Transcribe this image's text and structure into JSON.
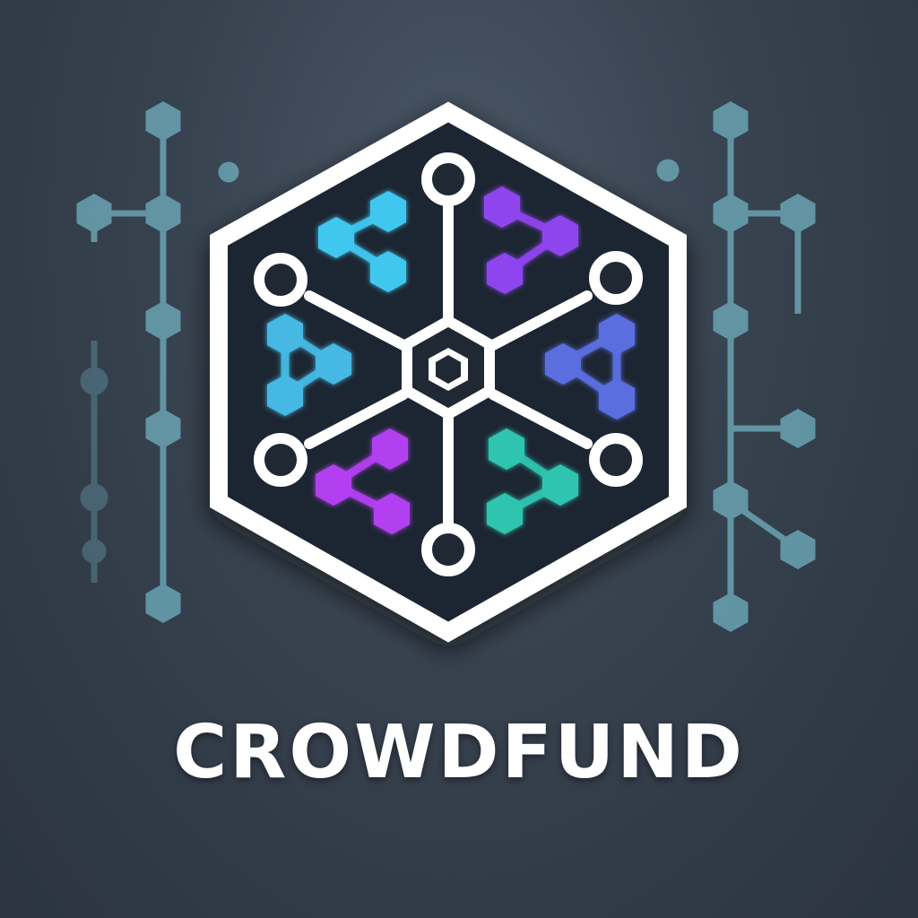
{
  "brand": {
    "name": "CROWDFUND"
  },
  "colors": {
    "background": "#37424f",
    "circuit": "#6aa3b3",
    "hex_outline": "#ffffff",
    "hex_fill": "#1f2833",
    "cluster_top_left": "#3fc7ef",
    "cluster_top_right": "#8e44ee",
    "cluster_left": "#44b8e4",
    "cluster_right": "#5a6ee0",
    "cluster_bottom_left": "#b23ff0",
    "cluster_bottom_right": "#2ec4b0"
  },
  "icons": {
    "logo": "hexagon-network-icon",
    "decoration": "circuit-trace-icon"
  }
}
